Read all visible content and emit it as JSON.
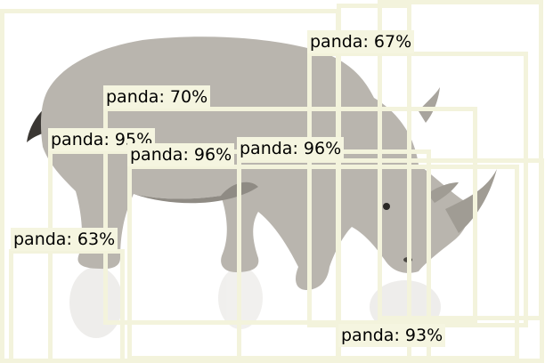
{
  "detections": [
    {
      "label": "panda: 67%",
      "score": 0.67
    },
    {
      "label": "panda: 70%",
      "score": 0.7
    },
    {
      "label": "panda: 95%",
      "score": 0.95
    },
    {
      "label": "panda: 96%",
      "score": 0.96
    },
    {
      "label": "panda: 96%",
      "score": 0.96
    },
    {
      "label": "panda: 63%",
      "score": 0.63
    },
    {
      "label": "panda: 93%",
      "score": 0.93
    }
  ],
  "colors": {
    "box": "#f3f3dc",
    "label_bg": "#f5f5e0",
    "label_text": "#000000",
    "rhino_body": "#b9b5ae",
    "rhino_shadow": "#8f8b84",
    "background": "#ffffff"
  }
}
